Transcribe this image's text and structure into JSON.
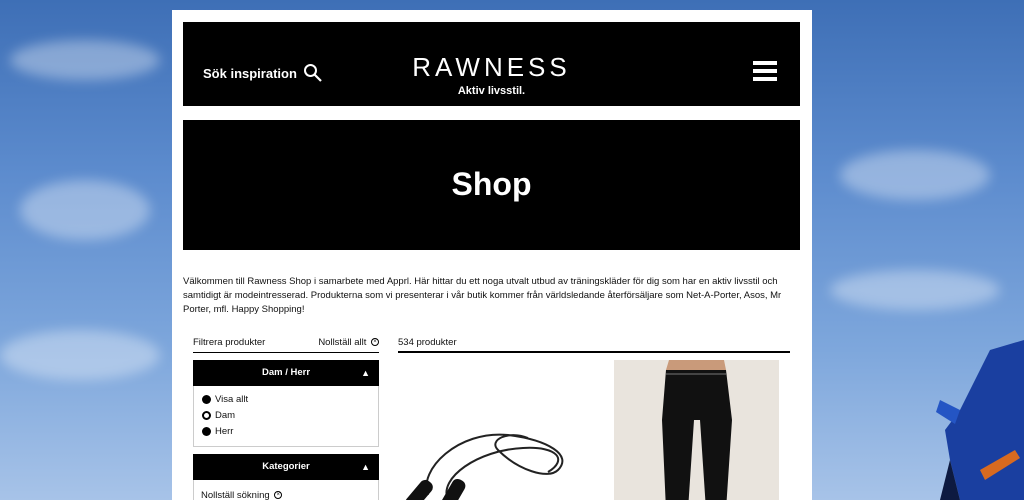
{
  "header": {
    "search_label": "Sök inspiration",
    "logo": "RAWNESS",
    "tagline": "Aktiv livsstil."
  },
  "hero": {
    "title": "Shop"
  },
  "intro": "Välkommen till Rawness Shop i samarbete med Apprl. Här hittar du ett noga utvalt utbud av träningskläder för dig som har en aktiv livsstil och samtidigt är modeintresserad. Produkterna som vi presenterar i vår butik kommer från världsledande återförsäljare som Net-A-Porter, Asos, Mr Porter, mfl. Happy Shopping!",
  "filters": {
    "title": "Filtrera produkter",
    "reset_all": "Nollställ allt",
    "gender": {
      "title": "Dam / Herr",
      "options": [
        {
          "label": "Visa allt",
          "selected": false
        },
        {
          "label": "Dam",
          "selected": true
        },
        {
          "label": "Herr",
          "selected": false
        }
      ]
    },
    "categories": {
      "title": "Kategorier",
      "reset": "Nollställ sökning"
    }
  },
  "products": {
    "count_label": "534 produkter"
  },
  "colors": {
    "header_bg": "#000000",
    "page_bg": "#ffffff",
    "sky": "#5d8cce"
  }
}
